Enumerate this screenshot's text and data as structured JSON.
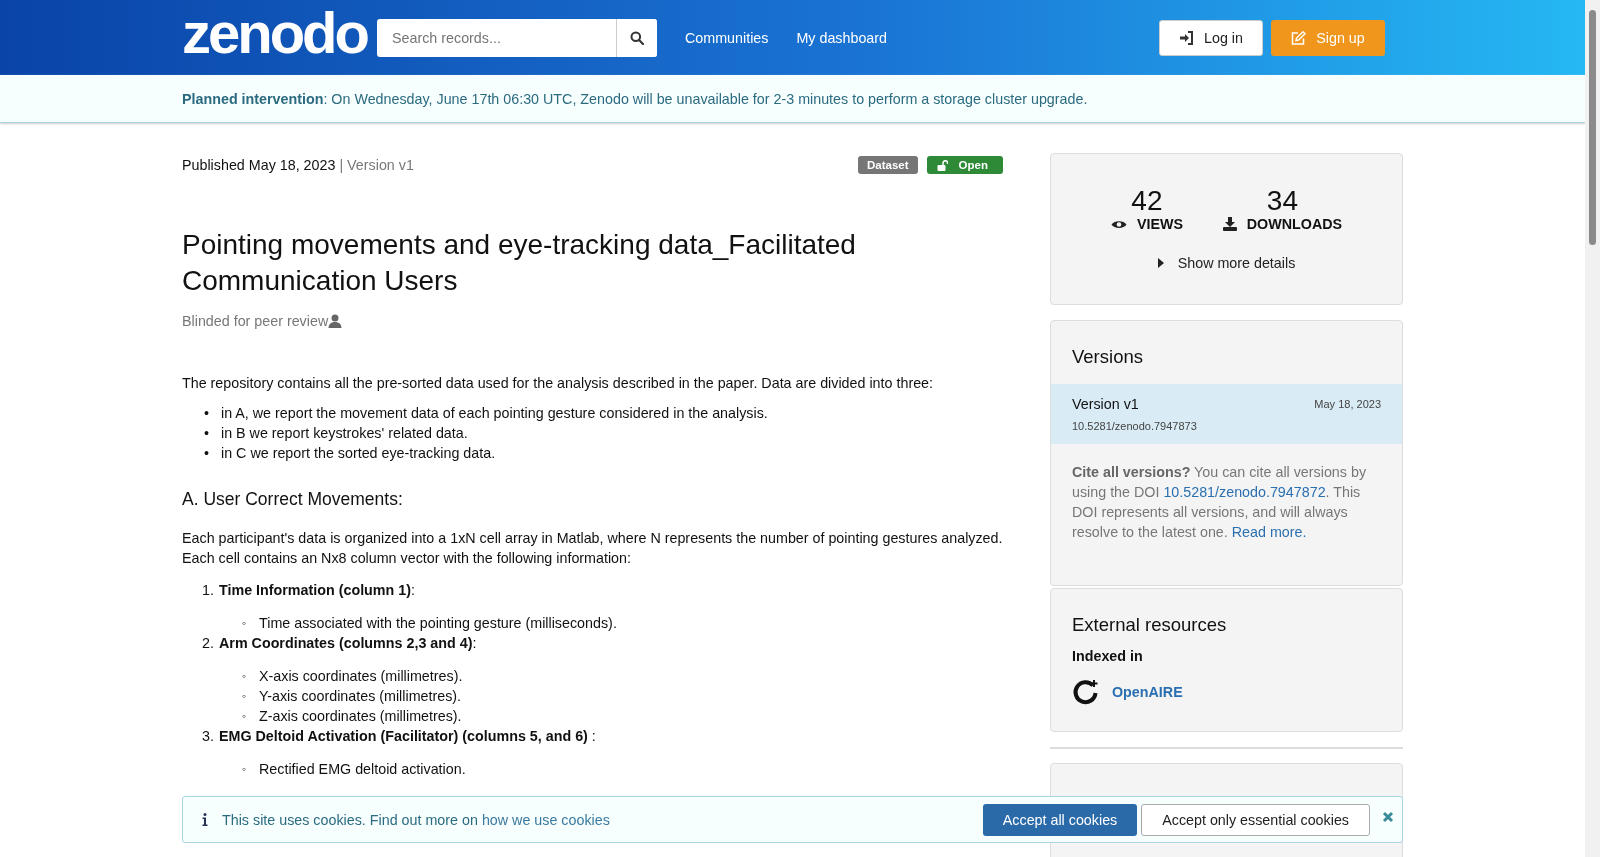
{
  "header": {
    "logo": "zenodo",
    "search": {
      "placeholder": "Search records..."
    },
    "nav": [
      "Communities",
      "My dashboard"
    ],
    "login": "Log in",
    "signup": "Sign up"
  },
  "banner": "**Planned intervention**: On Wednesday, June 17th 06:30 UTC, Zenodo will be unavailable for 2-3 minutes to perform a storage cluster upgrade.",
  "record": {
    "published": "Published May 18, 2023",
    "version": "| Version v1",
    "badges": [
      {
        "label": "Dataset",
        "kind": "type"
      },
      {
        "label": "Open",
        "kind": "access"
      }
    ],
    "title": "Pointing movements and eye-tracking data_Facilitated Communication Users",
    "creator": "Blinded for peer review",
    "intro": "The repository contains all the pre-sorted data used for the analysis described in the paper. Data are divided into three:",
    "bullets": [
      {
        "marker": "•",
        "text": "in A, we report the movement data of each pointing gesture considered in the analysis."
      },
      {
        "marker": "•",
        "text": "in B we report keystrokes' related data."
      },
      {
        "marker": "•",
        "text": "in C we report the sorted eye-tracking data."
      }
    ],
    "section_heading": "A. User Correct Movements:",
    "section_text": "Each participant's data is organized into a 1xN cell array in Matlab, where N represents the number of pointing gestures analyzed. Each cell contains an Nx8 column vector with the following information:",
    "items": [
      {
        "marker": "1.",
        "text": "**Time Information (column 1)**:",
        "children": [
          {
            "marker": "◦",
            "text": "Time associated with the pointing gesture (milliseconds)."
          }
        ]
      },
      {
        "marker": "2.",
        "text": "**Arm Coordinates (columns 2,3 and 4)**:",
        "children": [
          {
            "marker": "◦",
            "text": "X-axis coordinates (millimetres)."
          },
          {
            "marker": "◦",
            "text": "Y-axis coordinates (millimetres)."
          },
          {
            "marker": "◦",
            "text": "Z-axis coordinates (millimetres)."
          }
        ]
      },
      {
        "marker": "3.",
        "text": "**EMG Deltoid Activation (Facilitator) (columns 5, and 6)** :",
        "children": [
          {
            "marker": "◦",
            "text": "Rectified EMG deltoid activation."
          }
        ]
      }
    ]
  },
  "stats": [
    {
      "value": "42",
      "label": "VIEWS",
      "kind": "views"
    },
    {
      "value": "34",
      "label": "DOWNLOADS",
      "kind": "downloads"
    }
  ],
  "show_more": "Show more details",
  "versions": {
    "title": "Versions",
    "items": [
      {
        "name": "Version v1",
        "date": "May 18, 2023",
        "doi": "10.5281/zenodo.7947873",
        "selected": true
      }
    ],
    "cite_bold": "Cite all versions?",
    "cite_1": "You can cite all versions by using the DOI",
    "cite_doi": "10.5281/zenodo.7947872",
    "cite_2": ". This DOI represents all versions, and will always resolve to the latest one.",
    "read_more": "Read more."
  },
  "external": {
    "title": "External resources",
    "indexed": "Indexed in",
    "link": "OpenAIRE"
  },
  "cookies": {
    "text": "This site uses cookies. Find out more on",
    "link": "how we use cookies",
    "accept_all": "Accept all cookies",
    "accept_essential": "Accept only essential cookies"
  }
}
